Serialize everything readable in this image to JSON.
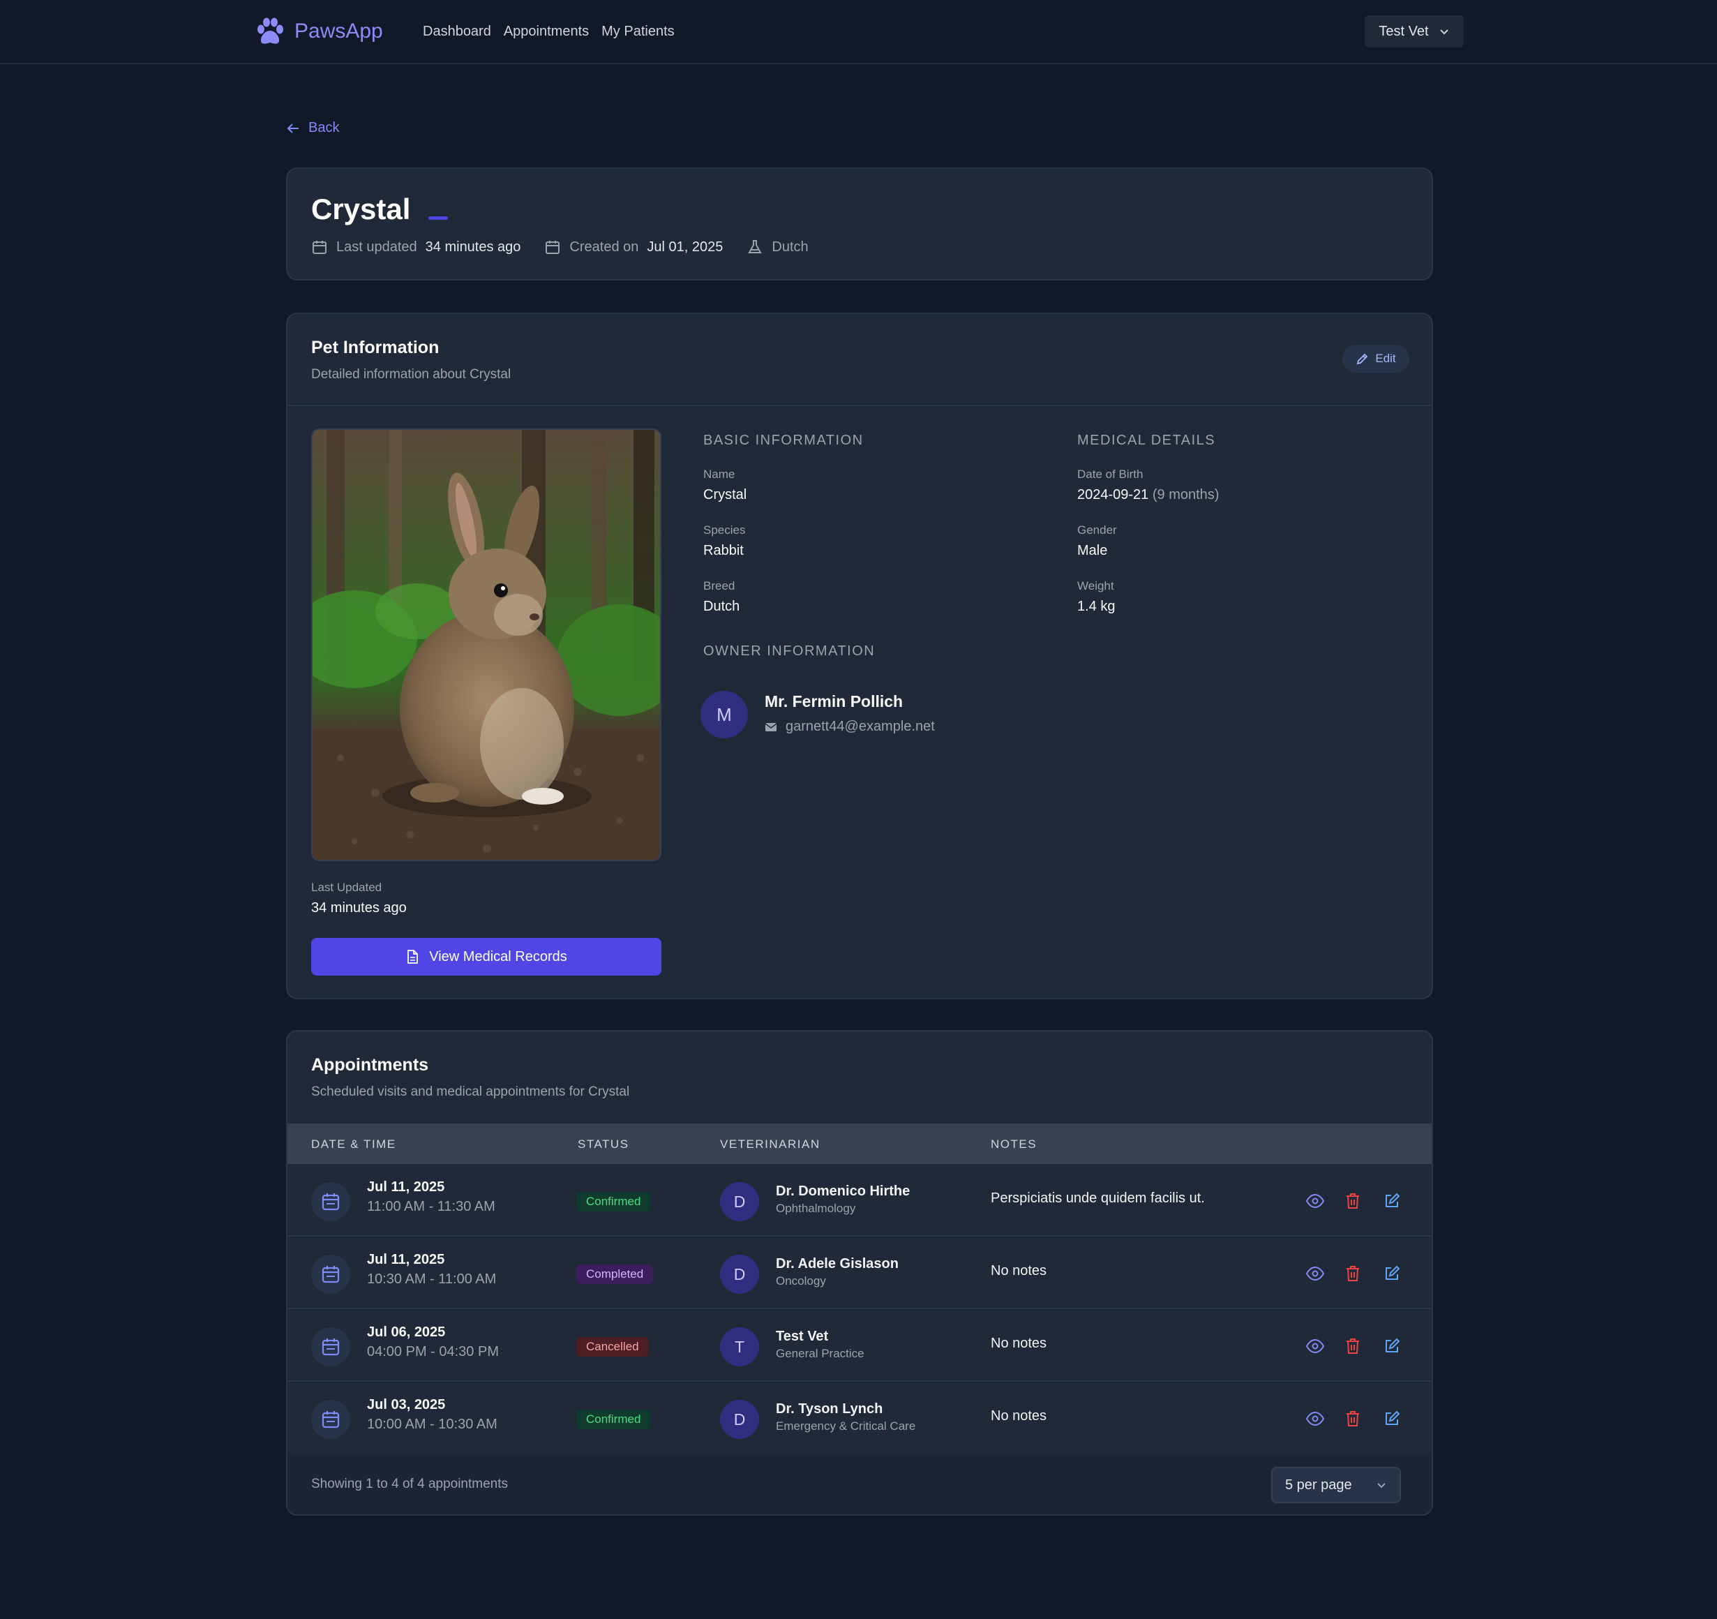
{
  "app": {
    "name": "PawsApp"
  },
  "nav": {
    "links": [
      "Dashboard",
      "Appointments",
      "My Patients"
    ],
    "user": "Test Vet"
  },
  "back_label": "Back",
  "header": {
    "pet_name": "Crystal",
    "last_updated_label": "Last updated",
    "last_updated_value": "34 minutes ago",
    "created_label": "Created on",
    "created_value": "Jul 01, 2025",
    "breed": "Dutch"
  },
  "pet_info": {
    "title": "Pet Information",
    "subtitle": "Detailed information about Crystal",
    "edit_label": "Edit",
    "basic_title": "BASIC INFORMATION",
    "medical_title": "MEDICAL DETAILS",
    "owner_title": "OWNER INFORMATION",
    "name_label": "Name",
    "name": "Crystal",
    "species_label": "Species",
    "species": "Rabbit",
    "breed_label": "Breed",
    "breed": "Dutch",
    "dob_label": "Date of Birth",
    "dob": "2024-09-21",
    "age": "(9 months)",
    "gender_label": "Gender",
    "gender": "Male",
    "weight_label": "Weight",
    "weight": "1.4 kg",
    "owner_initial": "M",
    "owner_name": "Mr. Fermin Pollich",
    "owner_email": "garnett44@example.net",
    "last_updated_label": "Last Updated",
    "last_updated": "34 minutes ago",
    "view_records_label": "View Medical Records"
  },
  "appointments": {
    "title": "Appointments",
    "subtitle": "Scheduled visits and medical appointments for Crystal",
    "columns": [
      "DATE & TIME",
      "STATUS",
      "VETERINARIAN",
      "NOTES"
    ],
    "rows": [
      {
        "date": "Jul 11, 2025",
        "time": "11:00 AM - 11:30 AM",
        "status": "Confirmed",
        "vet_initial": "D",
        "vet": "Dr. Domenico Hirthe",
        "specialty": "Ophthalmology",
        "notes": "Perspiciatis unde quidem facilis ut."
      },
      {
        "date": "Jul 11, 2025",
        "time": "10:30 AM - 11:00 AM",
        "status": "Completed",
        "vet_initial": "D",
        "vet": "Dr. Adele Gislason",
        "specialty": "Oncology",
        "notes": "No notes"
      },
      {
        "date": "Jul 06, 2025",
        "time": "04:00 PM - 04:30 PM",
        "status": "Cancelled",
        "vet_initial": "T",
        "vet": "Test Vet",
        "specialty": "General Practice",
        "notes": "No notes"
      },
      {
        "date": "Jul 03, 2025",
        "time": "10:00 AM - 10:30 AM",
        "status": "Confirmed",
        "vet_initial": "D",
        "vet": "Dr. Tyson Lynch",
        "specialty": "Emergency & Critical Care",
        "notes": "No notes"
      }
    ],
    "showing": "Showing 1 to 4 of 4 appointments",
    "per_page": "5 per page"
  },
  "colors": {
    "accent": "#4f46e5",
    "confirmed_bg": "#0f3b2e",
    "confirmed_fg": "#4ade80",
    "completed_bg": "#3b1f5c",
    "completed_fg": "#d8b4fe",
    "cancelled_bg": "#4c1d24",
    "cancelled_fg": "#fca5a5"
  }
}
